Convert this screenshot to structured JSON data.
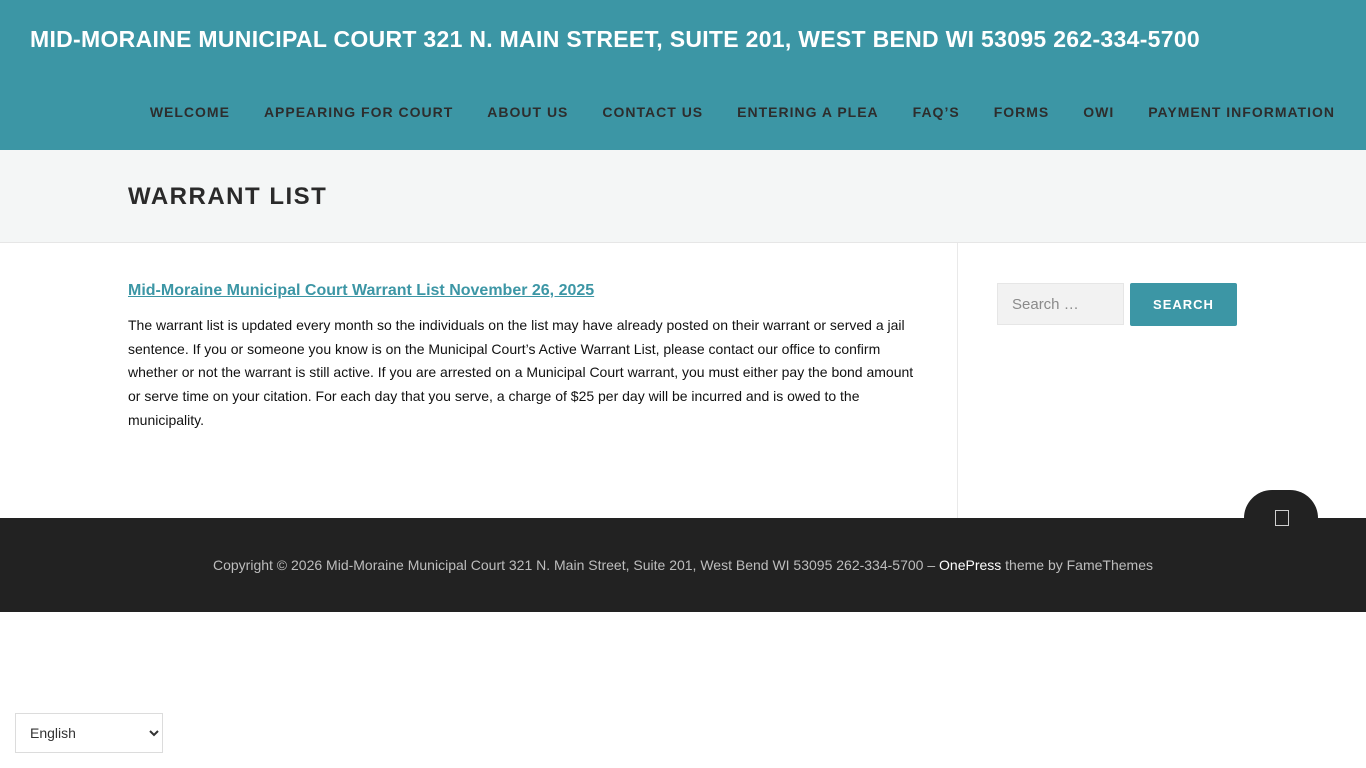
{
  "header": {
    "site_title": "MID-MORAINE MUNICIPAL COURT 321 N. MAIN STREET, SUITE 201, WEST BEND WI 53095 262-334-5700"
  },
  "nav": {
    "items": [
      {
        "label": "WELCOME"
      },
      {
        "label": "APPEARING FOR COURT"
      },
      {
        "label": "ABOUT US"
      },
      {
        "label": "CONTACT US"
      },
      {
        "label": "ENTERING A PLEA"
      },
      {
        "label": "FAQ’S"
      },
      {
        "label": "FORMS"
      },
      {
        "label": "OWI"
      },
      {
        "label": "PAYMENT INFORMATION"
      }
    ]
  },
  "page": {
    "title": "WARRANT LIST"
  },
  "post": {
    "title": "Mid-Moraine Municipal Court Warrant List November 26, 2025",
    "body": "The warrant list is updated every month so the individuals on the list may have already posted on their warrant or served a jail sentence.  If you or someone you know is on the Municipal Court’s Active Warrant List, please contact our office to confirm whether or not the warrant is still active.  If you are arrested on a Municipal Court warrant, you must either pay the bond amount or serve time on your citation.  For each day that you serve, a charge of $25 per day will be incurred and is owed to the municipality."
  },
  "sidebar": {
    "search_placeholder": "Search …",
    "search_button": "SEARCH"
  },
  "footer": {
    "copyright": "Copyright © 2026 Mid-Moraine Municipal Court 321 N. Main Street, Suite 201, West Bend WI 53095 262-334-5700 – ",
    "theme_link": "OnePress",
    "theme_suffix": " theme by FameThemes"
  },
  "language": {
    "selected": "English"
  },
  "colors": {
    "accent": "#3c96a5",
    "footer_bg": "#222222",
    "page_header_bg": "#f4f6f6"
  },
  "icons": {
    "back_to_top": "back-to-top-icon"
  }
}
